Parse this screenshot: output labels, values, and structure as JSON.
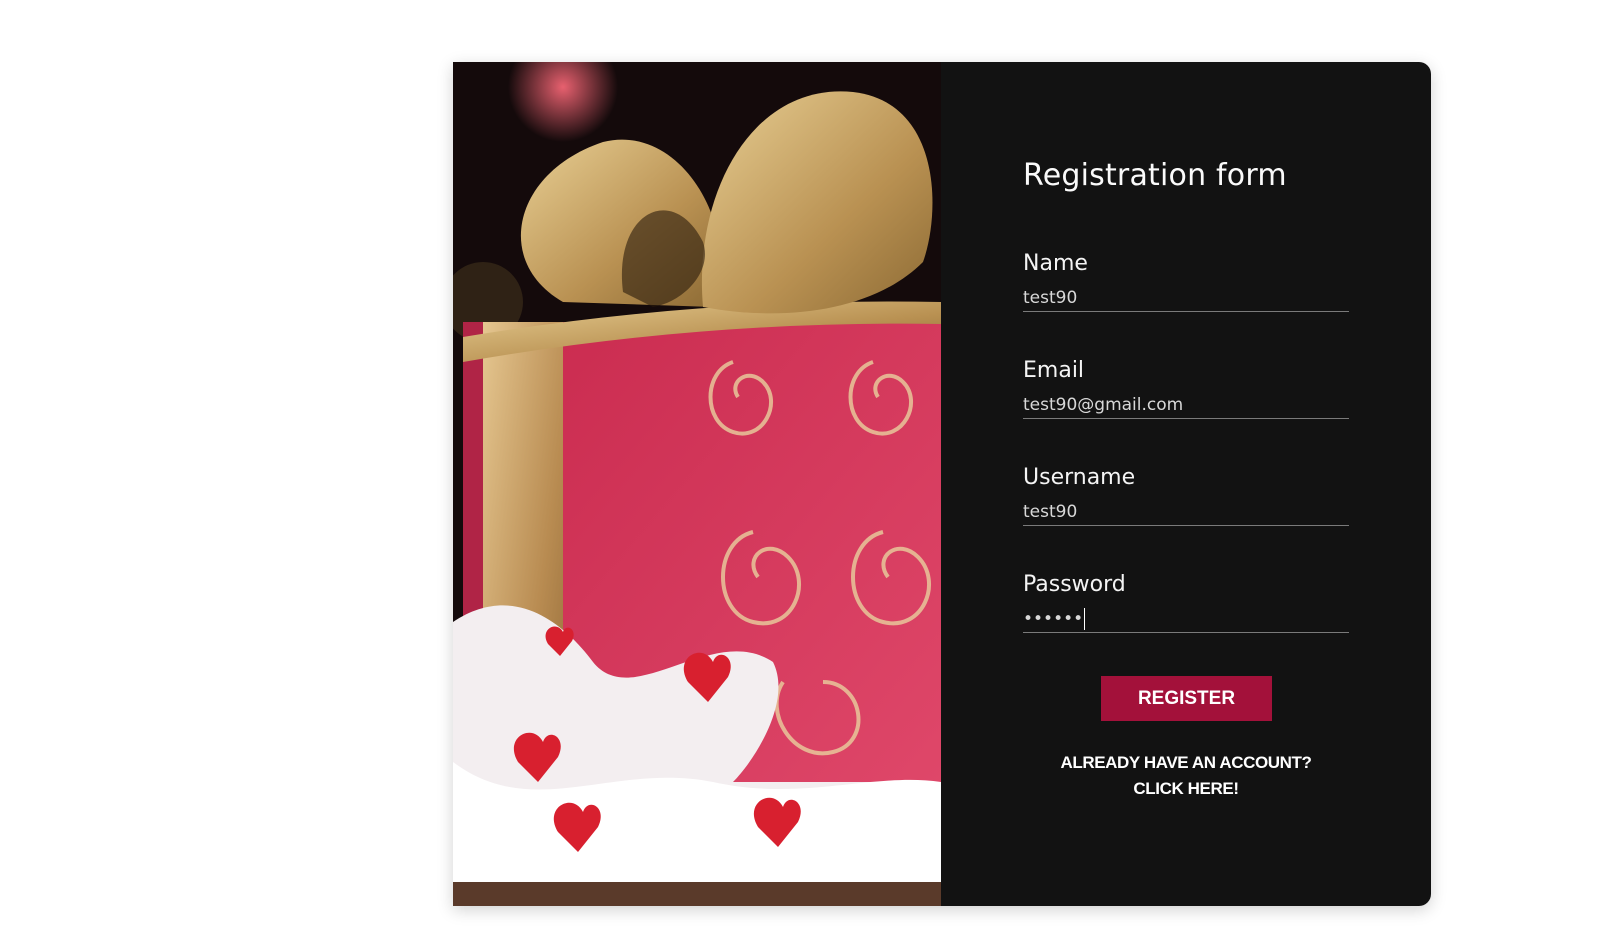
{
  "form": {
    "title": "Registration form",
    "fields": [
      {
        "label": "Name",
        "value": "test90"
      },
      {
        "label": "Email",
        "value": "test90@gmail.com"
      },
      {
        "label": "Username",
        "value": "test90"
      },
      {
        "label": "Password",
        "value": "••••••"
      }
    ],
    "register_label": "REGISTER",
    "login_line1": "ALREADY HAVE AN ACCOUNT?",
    "login_line2": "CLICK HERE!"
  },
  "colors": {
    "panel_bg": "#121212",
    "accent": "#a3113a",
    "gift_pink": "#d8365c",
    "ribbon_gold": "#c9a765"
  },
  "image": {
    "subject": "gift-box-photo"
  }
}
